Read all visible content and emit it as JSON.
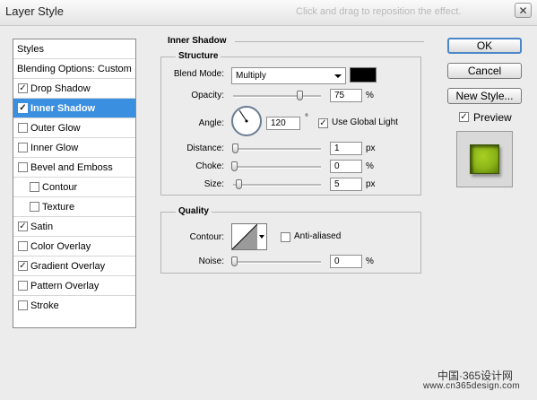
{
  "window": {
    "title": "Layer Style",
    "blurred_tip": "Click and drag to reposition the effect."
  },
  "styles_list": {
    "header": "Styles",
    "blending": "Blending Options: Custom",
    "items": [
      {
        "label": "Drop Shadow",
        "checked": true
      },
      {
        "label": "Inner Shadow",
        "checked": true,
        "selected": true
      },
      {
        "label": "Outer Glow",
        "checked": false
      },
      {
        "label": "Inner Glow",
        "checked": false
      },
      {
        "label": "Bevel and Emboss",
        "checked": false
      },
      {
        "label": "Contour",
        "checked": false
      },
      {
        "label": "Texture",
        "checked": false
      },
      {
        "label": "Satin",
        "checked": true
      },
      {
        "label": "Color Overlay",
        "checked": false
      },
      {
        "label": "Gradient Overlay",
        "checked": true
      },
      {
        "label": "Pattern Overlay",
        "checked": false
      },
      {
        "label": "Stroke",
        "checked": false
      }
    ]
  },
  "inner_shadow": {
    "title": "Inner Shadow",
    "structure": {
      "title": "Structure",
      "blend_mode_label": "Blend Mode:",
      "blend_mode": "Multiply",
      "shadow_color": "#000000",
      "opacity_label": "Opacity:",
      "opacity": "75",
      "opacity_unit": "%",
      "angle_label": "Angle:",
      "angle": "120",
      "angle_unit": "°",
      "use_global_light_label": "Use Global Light",
      "use_global_light": true,
      "distance_label": "Distance:",
      "distance": "1",
      "distance_unit": "px",
      "choke_label": "Choke:",
      "choke": "0",
      "choke_unit": "%",
      "size_label": "Size:",
      "size": "5",
      "size_unit": "px"
    },
    "quality": {
      "title": "Quality",
      "contour_label": "Contour:",
      "anti_aliased_label": "Anti-aliased",
      "anti_aliased": false,
      "noise_label": "Noise:",
      "noise": "0",
      "noise_unit": "%"
    }
  },
  "buttons": {
    "ok": "OK",
    "cancel": "Cancel",
    "new_style": "New Style...",
    "preview_label": "Preview",
    "preview": true
  },
  "preview_color": "#8bb417",
  "watermark": {
    "cn": "中国·365设计网",
    "url": "www.cn365design.com"
  }
}
